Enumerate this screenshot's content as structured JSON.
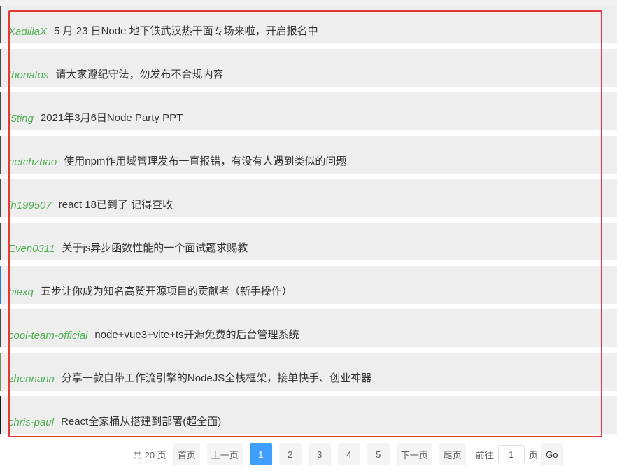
{
  "topics": [
    {
      "author": "XadillaX",
      "title": "5 月 23 日Node 地下铁武汉热干面专场来啦，开启报名中"
    },
    {
      "author": "thonatos",
      "title": "请大家遵纪守法，勿发布不合规内容"
    },
    {
      "author": "i5ting",
      "title": "2021年3月6日Node Party PPT"
    },
    {
      "author": "netchzhao",
      "title": "使用npm作用域管理发布一直报错，有没有人遇到类似的问题"
    },
    {
      "author": "lh199507",
      "title": "react 18已到了 记得查收"
    },
    {
      "author": "Even0311",
      "title": "关于js异步函数性能的一个面试题求赐教"
    },
    {
      "author": "hiexq",
      "title": "五步让你成为知名高赞开源项目的贡献者（新手操作）"
    },
    {
      "author": "cool-team-official",
      "title": "node+vue3+vite+ts开源免费的后台管理系统"
    },
    {
      "author": "zhennann",
      "title": "分享一款自带工作流引擎的NodeJS全栈框架，接单快手、创业神器"
    },
    {
      "author": "chris-paul",
      "title": "React全家桶从搭建到部署(超全面)"
    }
  ],
  "pagination": {
    "total": "共 20 页",
    "first": "首页",
    "prev": "上一页",
    "pages": [
      "1",
      "2",
      "3",
      "4",
      "5"
    ],
    "active_page": "1",
    "next": "下一页",
    "last": "尾页",
    "goto_label": "前往",
    "goto_value": "1",
    "page_unit": "页",
    "go": "Go"
  },
  "colors": {
    "author": "#4caf50",
    "highlight_border": "#e53935",
    "active_page": "#409eff"
  }
}
